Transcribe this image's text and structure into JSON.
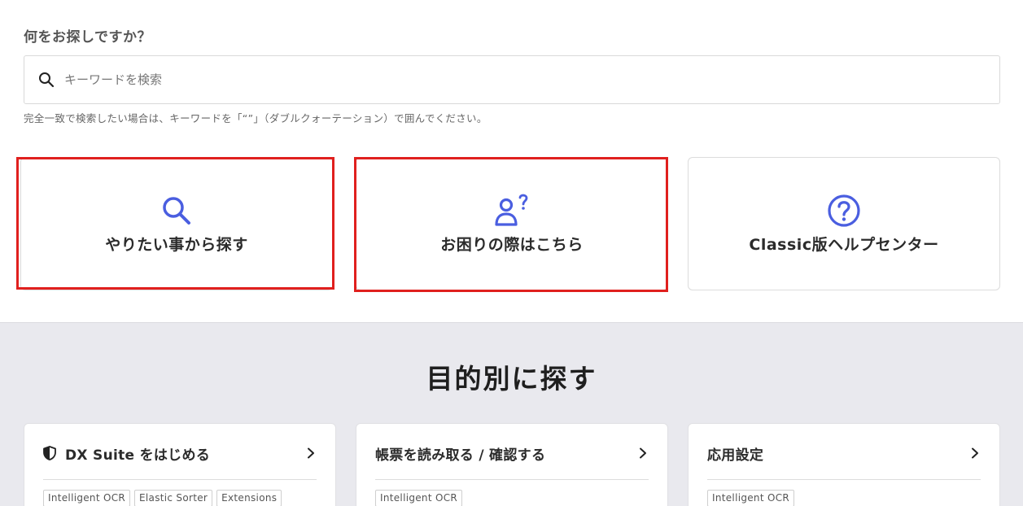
{
  "search": {
    "heading": "何をお探しですか？",
    "placeholder": "キーワードを検索",
    "value": "",
    "hint": "完全一致で検索したい場合は、キーワードを「“”」（ダブルクォーテーション）で囲んでください。",
    "icon": "search-icon"
  },
  "quick_cards": [
    {
      "label": "やりたい事から探す",
      "icon": "search-icon",
      "highlighted": true
    },
    {
      "label": "お困りの際はこちら",
      "icon": "person-question-icon",
      "highlighted": true
    },
    {
      "label": "Classic版ヘルプセンター",
      "icon": "question-circle-icon",
      "highlighted": false
    }
  ],
  "purpose": {
    "title": "目的別に探す",
    "cards": [
      {
        "title": "DX Suite をはじめる",
        "icon": "shield-icon",
        "tags": [
          "Intelligent OCR",
          "Elastic Sorter",
          "Extensions"
        ]
      },
      {
        "title": "帳票を読み取る / 確認する",
        "tags": [
          "Intelligent OCR"
        ]
      },
      {
        "title": "応用設定",
        "tags": [
          "Intelligent OCR"
        ]
      }
    ]
  },
  "colors": {
    "accent": "#4a5ee0",
    "highlight": "#e0201e",
    "section_bg": "#e9e9ee"
  }
}
